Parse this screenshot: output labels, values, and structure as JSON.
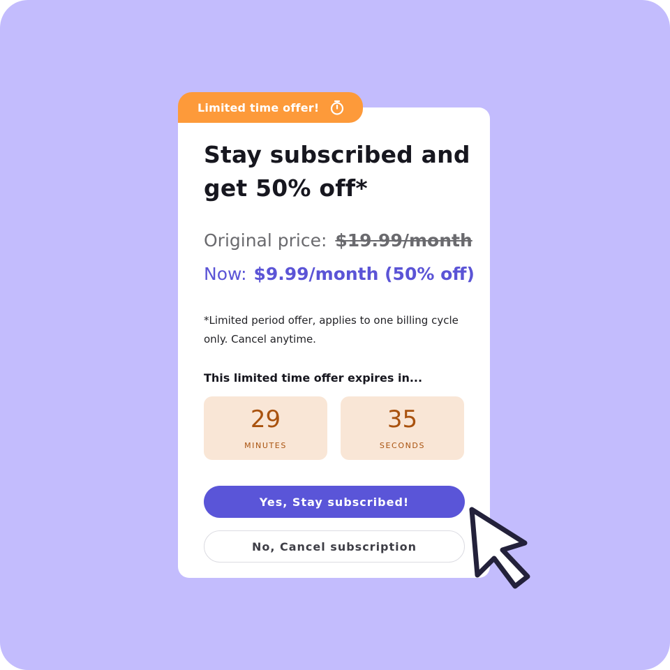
{
  "offer_badge": {
    "label": "Limited time offer!",
    "icon": "stopwatch-icon"
  },
  "headline": "Stay subscribed and get 50% off*",
  "pricing": {
    "original_label": "Original price:",
    "original_value": "$19.99/month",
    "now_label": "Now:",
    "now_value": "$9.99/month (50% off)"
  },
  "disclaimer": "*Limited period offer, applies to one billing cycle only. Cancel anytime.",
  "countdown": {
    "label": "This limited time offer expires in...",
    "minutes": "29",
    "minutes_unit": "MINUTES",
    "seconds": "35",
    "seconds_unit": "SECONDS"
  },
  "actions": {
    "stay_label": "Yes, Stay subscribed!",
    "cancel_label": "No, Cancel subscription"
  },
  "pointer": {
    "icon": "mouse-pointer-icon"
  },
  "colors": {
    "background": "#c3bcfd",
    "badge": "#fd9a3a",
    "accent": "#5a55d8",
    "timer_bg": "#f9e6d6",
    "timer_text": "#a9520e"
  }
}
